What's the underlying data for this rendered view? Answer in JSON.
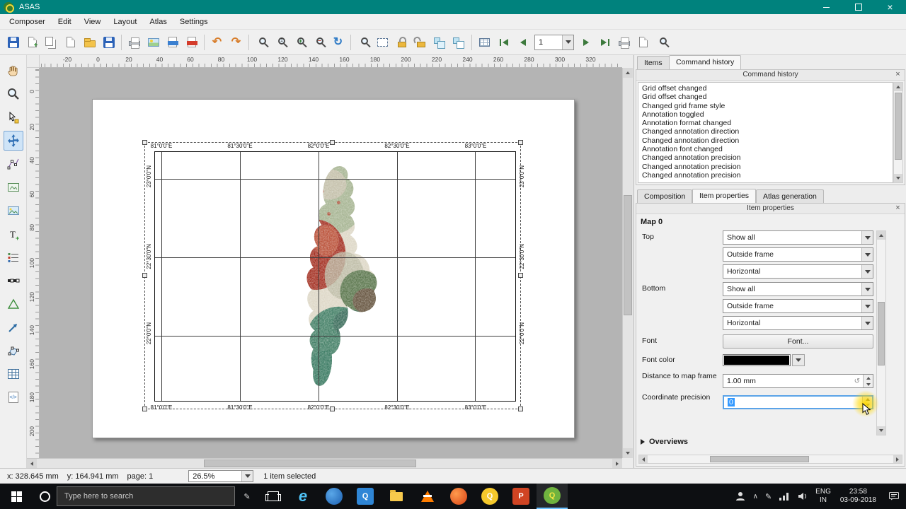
{
  "window": {
    "title": "ASAS"
  },
  "menu_bar": {
    "items": [
      "Composer",
      "Edit",
      "View",
      "Layout",
      "Atlas",
      "Settings"
    ]
  },
  "toolbar": {
    "page_value": "1",
    "icons": [
      "save-project",
      "new-composition",
      "duplicate-composition",
      "composition-manager",
      "load-template",
      "save-template",
      "print",
      "export-image",
      "export-svg",
      "export-pdf",
      "undo",
      "redo",
      "zoom-full",
      "zoom-100",
      "zoom-in",
      "zoom-out",
      "refresh-view",
      "zoom-region",
      "select-items",
      "lock-items",
      "unlock-items",
      "group-items",
      "ungroup-items",
      "atlas-preview",
      "first-feature",
      "previous-feature",
      "atlas-feature-number",
      "next-feature",
      "last-feature",
      "print-atlas",
      "export-atlas",
      "atlas-settings"
    ]
  },
  "left_toolbar": {
    "icons": [
      "pan-composer",
      "zoom-composer",
      "select-move-item",
      "move-item-content",
      "edit-nodes-item",
      "add-new-map",
      "add-image",
      "add-new-label",
      "add-new-legend",
      "add-new-scalebar",
      "add-basic-shape",
      "add-arrow",
      "add-nodes-item",
      "add-attribute-table",
      "add-html-frame"
    ],
    "active": "move-item-content"
  },
  "rulers": {
    "top": [
      "-20",
      "0",
      "20",
      "40",
      "60",
      "80",
      "100",
      "120",
      "140",
      "160",
      "180",
      "200",
      "220",
      "240",
      "260",
      "280",
      "300",
      "320"
    ],
    "left": [
      "0",
      "20",
      "40",
      "60",
      "80",
      "100",
      "120",
      "140",
      "160",
      "180",
      "200"
    ]
  },
  "map_item": {
    "lon_labels": [
      "81°0'0\"E",
      "81°30'0\"E",
      "82°0'0\"E",
      "82°30'0\"E",
      "83°0'0\"E"
    ],
    "lat_labels": [
      "23°0'0\"N",
      "22°30'0\"N",
      "22°0'0\"N"
    ]
  },
  "panels": {
    "top_tabs": {
      "items": [
        "Items",
        "Command history"
      ],
      "active": "Command history"
    },
    "command_history": {
      "title": "Command history",
      "entries": [
        "Grid offset changed",
        "Grid offset changed",
        "Changed grid frame style",
        "Annotation toggled",
        "Annotation format changed",
        "Changed annotation direction",
        "Changed annotation direction",
        "Annotation font changed",
        "Changed annotation precision",
        "Changed annotation precision",
        "Changed annotation precision"
      ]
    },
    "bottom_tabs": {
      "items": [
        "Composition",
        "Item properties",
        "Atlas generation"
      ],
      "active": "Item properties"
    },
    "item_properties": {
      "title": "Item properties",
      "section": "Map 0",
      "top_label": "Top",
      "bottom_label": "Bottom",
      "top_show": "Show all",
      "top_frame": "Outside frame",
      "top_direction": "Horizontal",
      "bottom_show": "Show all",
      "bottom_frame": "Outside frame",
      "bottom_direction": "Horizontal",
      "font_label": "Font",
      "font_button": "Font...",
      "font_color_label": "Font color",
      "font_color": "#000000",
      "distance_label": "Distance to map frame",
      "distance_value": "1.00 mm",
      "precision_label": "Coordinate precision",
      "precision_value": "0",
      "overviews_label": "Overviews"
    }
  },
  "status_bar": {
    "x": "x: 328.645 mm",
    "y": "y: 164.941 mm",
    "page": "page: 1",
    "zoom": "26.5%",
    "selection": "1 item selected"
  },
  "taskbar": {
    "search_text": "Type here to search",
    "icons": [
      "start",
      "cortana",
      "pen",
      "task-view",
      "edge",
      "app-blue",
      "qgis-browser",
      "file-explorer",
      "vlc",
      "app-orange",
      "qgis",
      "powerpoint",
      "qgis-active"
    ],
    "tray": {
      "language": "ENG",
      "region": "IN",
      "time": "23:58",
      "date": "03-09-2018",
      "icons": [
        "user",
        "chevron-up",
        "pen",
        "network",
        "volume",
        "notifications"
      ]
    }
  },
  "colors": {
    "titlebar": "#00827d",
    "accent": "#0078d7",
    "selection_highlight": "#3399ff",
    "click_highlight": "#ffd800"
  }
}
